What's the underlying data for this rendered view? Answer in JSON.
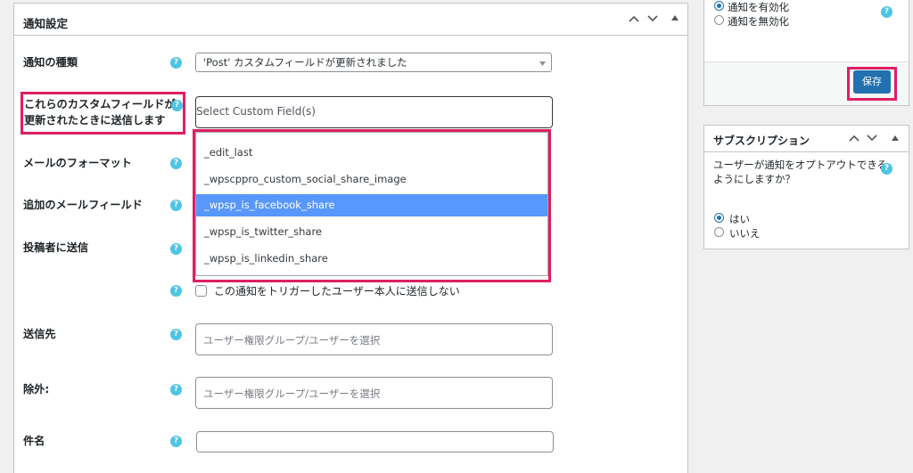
{
  "main": {
    "title": "通知設定",
    "rows": {
      "type": {
        "label": "通知の種類",
        "value": "'Post' カスタムフィールドが更新されました"
      },
      "custom_fields": {
        "label_line1": "これらのカスタムフィールドが",
        "label_line2": "更新されたときに送信します",
        "placeholder": "Select Custom Field(s)"
      },
      "format": {
        "label": "メールのフォーマット"
      },
      "extra_fields": {
        "label": "追加のメールフィールド"
      },
      "author": {
        "label": "投稿者に送信"
      },
      "no_trigger": {
        "label": "この通知をトリガーしたユーザー本人に送信しない"
      },
      "recipients": {
        "label": "送信先",
        "placeholder": "ユーザー権限グループ/ユーザーを選択"
      },
      "exclude": {
        "label": "除外:",
        "placeholder": "ユーザー権限グループ/ユーザーを選択"
      },
      "subject": {
        "label": "件名",
        "value": ""
      }
    },
    "dropdown_options": [
      "_edit_last",
      "_wpscppro_custom_social_share_image",
      "_wpsp_is_facebook_share",
      "_wpsp_is_twitter_share",
      "_wpsp_is_linkedin_share"
    ],
    "highlighted_option": "_wpsp_is_facebook_share"
  },
  "publish_box": {
    "radio_enable": "通知を有効化",
    "radio_disable": "通知を無効化",
    "selected": "enable",
    "save_label": "保存"
  },
  "subscription_box": {
    "title": "サブスクリプション",
    "question_line1": "ユーザーが通知をオプトアウトできる",
    "question_line2": "ようにしますか？",
    "yes": "はい",
    "no": "いいえ",
    "selected": "yes"
  },
  "icons": {
    "help": "?",
    "collapse_up": "chevron-up-icon",
    "collapse_down": "chevron-down-icon",
    "toggle": "triangle-up-icon",
    "select_arrow": "triangle-down-icon"
  },
  "colors": {
    "highlight_red": "#dd1f63",
    "help_icon": "#4cc5e6",
    "primary_button": "#2271b1",
    "option_highlight": "#5897fb"
  }
}
